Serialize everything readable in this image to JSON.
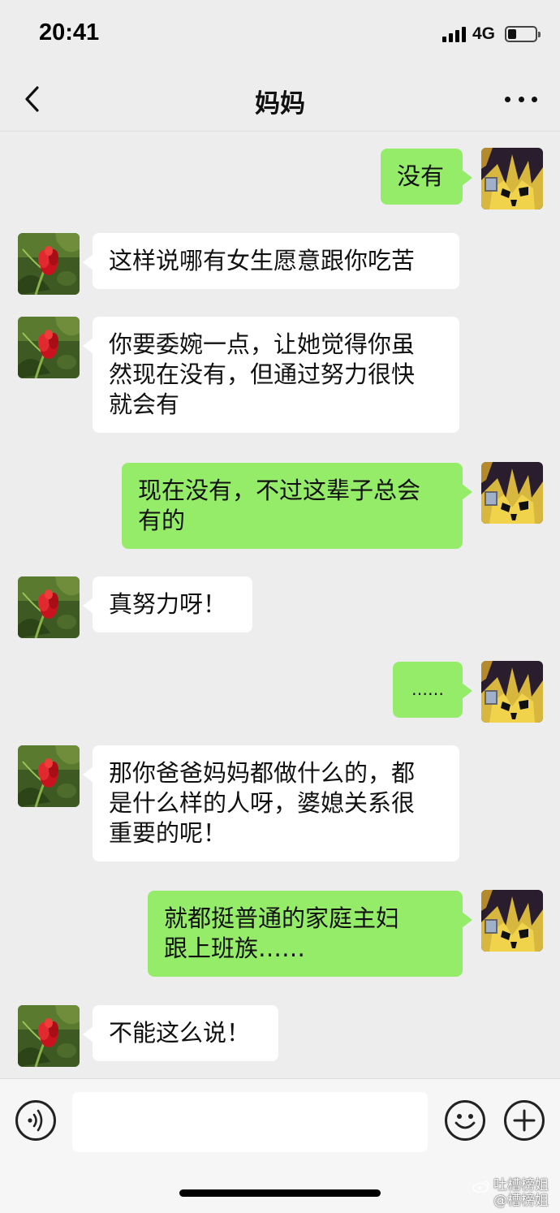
{
  "status_bar": {
    "time": "20:41",
    "network": "4G",
    "battery_level": 0.3
  },
  "nav": {
    "title": "妈妈",
    "back_icon": "chevron-left-icon",
    "more_icon": "more-dots-icon"
  },
  "messages": [
    {
      "from": "me",
      "lines": [
        "没有"
      ]
    },
    {
      "from": "contact",
      "lines": [
        "这样说哪有女生愿意跟你吃苦"
      ]
    },
    {
      "from": "contact",
      "lines": [
        "你要委婉一点，让她觉得你虽",
        "然现在没有，但通过努力很快",
        "就会有"
      ]
    },
    {
      "from": "me",
      "lines": [
        "现在没有，不过这辈子总会",
        "有的"
      ]
    },
    {
      "from": "contact",
      "lines": [
        "真努力呀！"
      ]
    },
    {
      "from": "me",
      "lines": [
        "……"
      ]
    },
    {
      "from": "contact",
      "lines": [
        "那你爸爸妈妈都做什么的，都",
        "是什么样的人呀，婆媳关系很",
        "重要的呢！"
      ]
    },
    {
      "from": "me",
      "lines": [
        "就都挺普通的家庭主妇",
        "跟上班族……"
      ]
    },
    {
      "from": "contact",
      "lines": [
        "不能这么说！"
      ]
    }
  ],
  "input_bar": {
    "voice_icon": "voice-icon",
    "input_value": "",
    "emoji_icon": "emoji-icon",
    "plus_icon": "plus-icon"
  },
  "watermark": {
    "line1": "吐槽榜姐",
    "line2": "@槽榜姐"
  },
  "colors": {
    "bubble_out": "#95ec69",
    "bubble_in": "#ffffff",
    "background": "#ededed"
  }
}
